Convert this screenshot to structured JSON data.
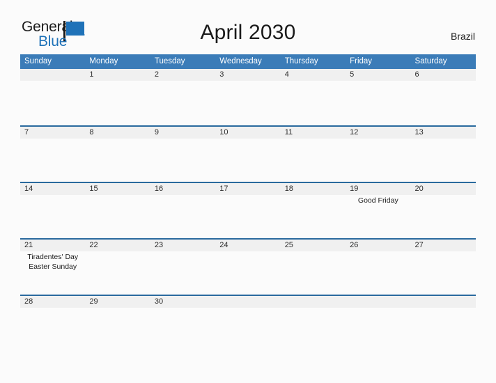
{
  "brand": {
    "word_one": "General",
    "word_two": "Blue",
    "flag_icon": "blue-flag-logo-icon",
    "primary_color": "#1f72b8"
  },
  "header": {
    "title": "April 2030",
    "region": "Brazil"
  },
  "colors": {
    "weekday_header_bg": "#3b7cb8",
    "week_divider": "#2a6a9e",
    "day_band_bg": "#f0f0f0",
    "page_bg": "#fbfbfb",
    "text": "#1b1b1b"
  },
  "calendar": {
    "weekdays": [
      "Sunday",
      "Monday",
      "Tuesday",
      "Wednesday",
      "Thursday",
      "Friday",
      "Saturday"
    ],
    "weeks": [
      {
        "days": [
          {
            "date": "",
            "events": []
          },
          {
            "date": "1",
            "events": []
          },
          {
            "date": "2",
            "events": []
          },
          {
            "date": "3",
            "events": []
          },
          {
            "date": "4",
            "events": []
          },
          {
            "date": "5",
            "events": []
          },
          {
            "date": "6",
            "events": []
          }
        ]
      },
      {
        "days": [
          {
            "date": "7",
            "events": []
          },
          {
            "date": "8",
            "events": []
          },
          {
            "date": "9",
            "events": []
          },
          {
            "date": "10",
            "events": []
          },
          {
            "date": "11",
            "events": []
          },
          {
            "date": "12",
            "events": []
          },
          {
            "date": "13",
            "events": []
          }
        ]
      },
      {
        "days": [
          {
            "date": "14",
            "events": []
          },
          {
            "date": "15",
            "events": []
          },
          {
            "date": "16",
            "events": []
          },
          {
            "date": "17",
            "events": []
          },
          {
            "date": "18",
            "events": []
          },
          {
            "date": "19",
            "events": [
              "Good Friday"
            ]
          },
          {
            "date": "20",
            "events": []
          }
        ]
      },
      {
        "days": [
          {
            "date": "21",
            "events": [
              "Tiradentes' Day",
              "Easter Sunday"
            ]
          },
          {
            "date": "22",
            "events": []
          },
          {
            "date": "23",
            "events": []
          },
          {
            "date": "24",
            "events": []
          },
          {
            "date": "25",
            "events": []
          },
          {
            "date": "26",
            "events": []
          },
          {
            "date": "27",
            "events": []
          }
        ]
      },
      {
        "days": [
          {
            "date": "28",
            "events": []
          },
          {
            "date": "29",
            "events": []
          },
          {
            "date": "30",
            "events": []
          },
          {
            "date": "",
            "events": []
          },
          {
            "date": "",
            "events": []
          },
          {
            "date": "",
            "events": []
          },
          {
            "date": "",
            "events": []
          }
        ]
      }
    ]
  }
}
